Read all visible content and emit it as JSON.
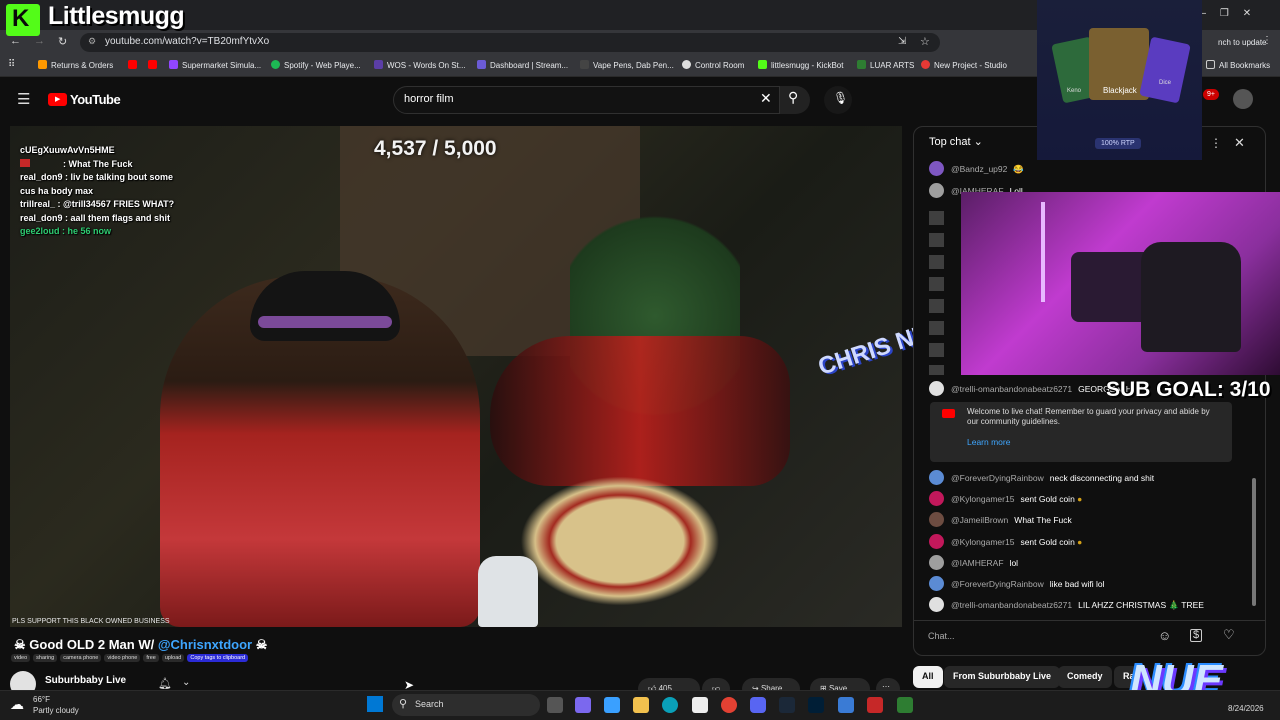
{
  "browser": {
    "url": "youtube.com/watch?v=TB20mfYtvXo",
    "update_label": "nch to update",
    "bookmarks": [
      "Returns & Orders",
      "Supermarket Simula...",
      "Spotify - Web Playe...",
      "WOS - Words On St...",
      "Dashboard | Stream...",
      "Vape Pens, Dab Pen...",
      "Control Room",
      "littlesmugg - KickBot",
      "LUAR ARTS",
      "New Project - Studio",
      "All Bookmarks"
    ]
  },
  "youtube": {
    "logo": "YouTube",
    "search_value": "horror film",
    "notification_count": "9+"
  },
  "video": {
    "counter": "4,537 / 5,000",
    "support_text": "PLS SUPPORT THIS BLACK OWNED BUSINESS",
    "graffiti": "CHRIS NDOOR",
    "chat_overlay": [
      "cUEgXuuwAvVn5HME",
      ": What The Fuck",
      "real_don9 : liv be talking bout some",
      "cus ha body max",
      "trillreal_ : @trill34567 FRIES WHAT?",
      "real_don9 : aall them flags and shit",
      "gee2loud : he 56 now"
    ],
    "title_prefix": "Good OLD 2 Man W/ ",
    "title_mention": "@Chrisnxtdoor",
    "tags": [
      "video",
      "sharing",
      "camera phone",
      "video phone",
      "free",
      "upload",
      "Copy tags to clipboard"
    ],
    "channel": "Suburbbaby Live",
    "likes": "405",
    "share": "Share",
    "save": "Save"
  },
  "chat": {
    "mode": "Top chat",
    "messages_top": [
      {
        "author": "@Bandz_up92",
        "text": "😂",
        "color": "#7e57c2"
      },
      {
        "author": "@IAMHERAF",
        "text": "Loll",
        "color": "#9e9e9e"
      }
    ],
    "pinned": {
      "author": "@trelli-omanbandonabeatz6271",
      "text": "GEORGE WHAT"
    },
    "welcome": "Welcome to live chat! Remember to guard your privacy and abide by our community guidelines.",
    "learn_more": "Learn more",
    "messages": [
      {
        "author": "@ForeverDyingRainbow",
        "text": "neck disconnecting and shit",
        "color": "#5b8bd4"
      },
      {
        "author": "@Kylongamer15",
        "text": "sent Gold coin",
        "color": "#c2185b"
      },
      {
        "author": "@JameilBrown",
        "text": "What The Fuck",
        "color": "#6d4c41"
      },
      {
        "author": "@Kylongamer15",
        "text": "sent Gold coin",
        "color": "#c2185b"
      },
      {
        "author": "@IAMHERAF",
        "text": "lol",
        "color": "#9e9e9e"
      },
      {
        "author": "@ForeverDyingRainbow",
        "text": "like bad wifi lol",
        "color": "#5b8bd4"
      },
      {
        "author": "@trelli-omanbandonabeatz6271",
        "text": "LIL AHZZ CHRISTMAS 🎄 TREE",
        "color": "#e0e0e0"
      }
    ],
    "placeholder": "Chat...",
    "chips": [
      "All",
      "From Suburbbaby Live",
      "Comedy",
      "Ra"
    ]
  },
  "overlays": {
    "streamer": "Littlesmugg",
    "casino_label": "Blackjack",
    "casino_left": "Keno",
    "casino_right": "Dice",
    "casino_rtp": "100% RTP",
    "sub_goal": "SUB GOAL: 3/10",
    "brand": "NUE"
  },
  "taskbar": {
    "temp": "66°F",
    "weather": "Partly cloudy",
    "search": "Search",
    "date": "8/24/2026"
  }
}
